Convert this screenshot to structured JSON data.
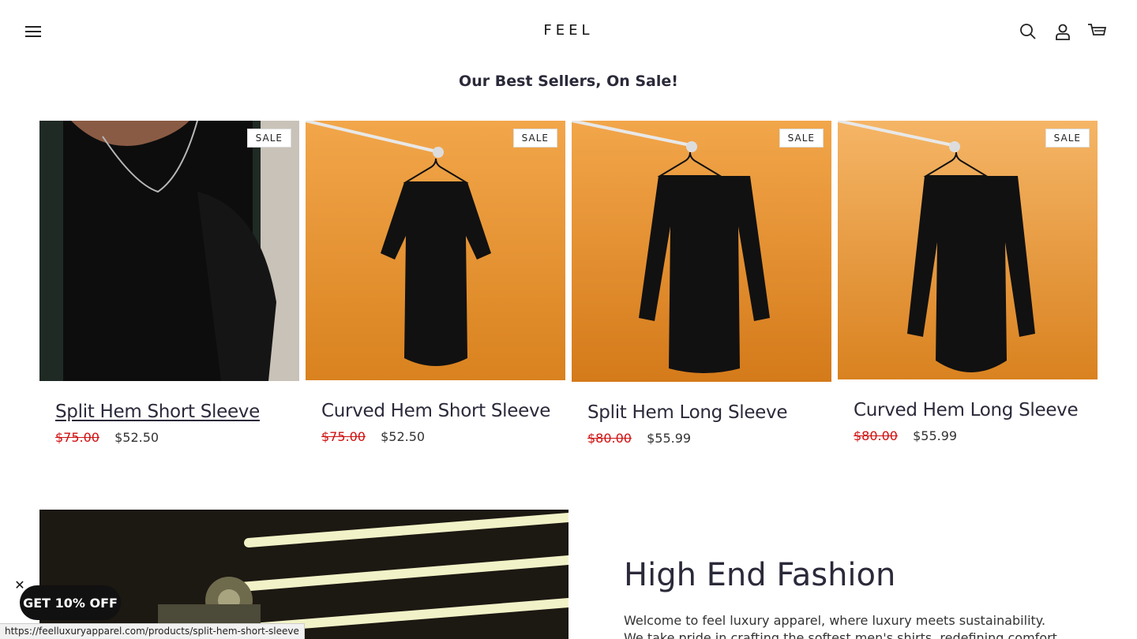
{
  "header": {
    "logo": "FEEL",
    "menu_icon": "hamburger-menu-icon",
    "search_icon": "search-icon",
    "account_icon": "user-icon",
    "cart_icon": "cart-icon"
  },
  "section": {
    "title": "Our Best Sellers, On Sale!"
  },
  "products": [
    {
      "title": "Split Hem Short Sleeve",
      "badge": "SALE",
      "old_price": "$75.00",
      "new_price": "$52.50"
    },
    {
      "title": "Curved Hem Short Sleeve",
      "badge": "SALE",
      "old_price": "$75.00",
      "new_price": "$52.50"
    },
    {
      "title": "Split Hem Long Sleeve",
      "badge": "SALE",
      "old_price": "$80.00",
      "new_price": "$55.99"
    },
    {
      "title": "Curved Hem Long Sleeve",
      "badge": "SALE",
      "old_price": "$80.00",
      "new_price": "$55.99"
    }
  ],
  "feature": {
    "title": "High End Fashion",
    "text": "Welcome to feel luxury apparel, where luxury meets sustainability. We take pride in crafting the softest men's shirts, redefining comfort"
  },
  "popup": {
    "close": "✕",
    "label": "GET 10% OFF"
  },
  "status_bar": {
    "url": "https://feelluxuryapparel.com/products/split-hem-short-sleeve"
  },
  "colors": {
    "sale_price": "#d01010",
    "text": "#2a2a3a",
    "orange_bg": "#e89a3c"
  }
}
